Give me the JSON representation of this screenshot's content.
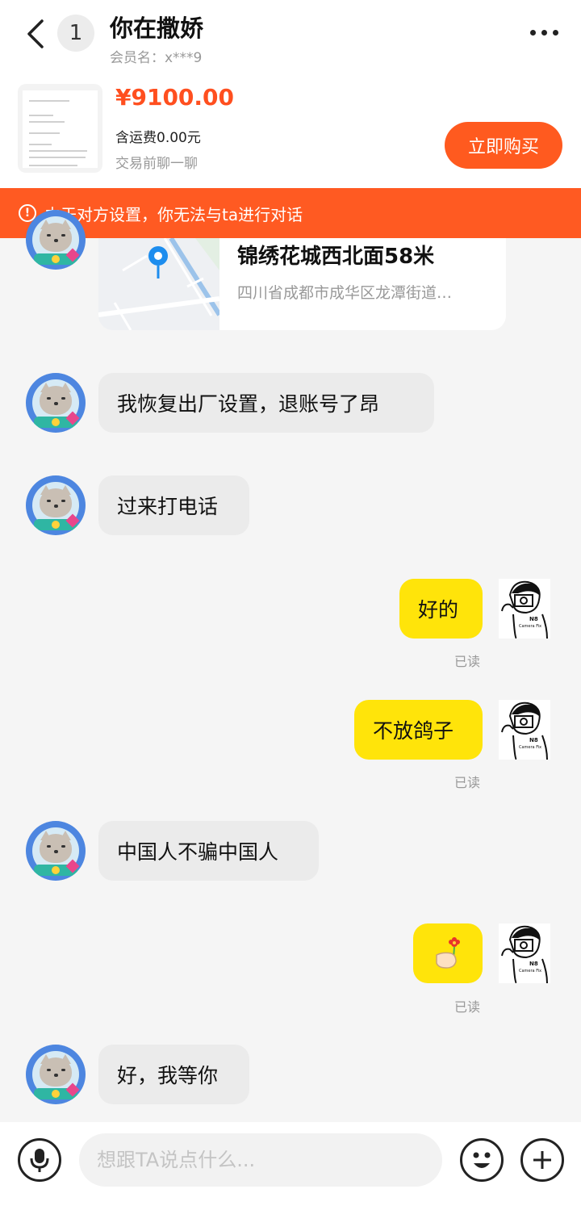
{
  "header": {
    "unread_count": "1",
    "title": "你在撒娇",
    "member_label": "会员名：x***9"
  },
  "product": {
    "price": "¥9100.00",
    "shipping": "含运费0.00元",
    "hint": "交易前聊一聊",
    "buy_label": "立即购买"
  },
  "warning": {
    "icon": "!",
    "text": "由于对方设置，你无法与ta进行对话"
  },
  "location": {
    "title": "锦绣花城西北面58米",
    "address": "四川省成都市成华区龙潭街道…"
  },
  "messages": [
    {
      "side": "in",
      "text": "我恢复出厂设置，退账号了昂"
    },
    {
      "side": "in",
      "text": "过来打电话"
    },
    {
      "side": "out",
      "text": "好的",
      "status": "已读"
    },
    {
      "side": "out",
      "text": "不放鸽子",
      "status": "已读"
    },
    {
      "side": "in",
      "text": "中国人不骗中国人"
    },
    {
      "side": "out",
      "text": "",
      "sticker": "flower-hand-sticker",
      "status": "已读"
    },
    {
      "side": "in",
      "text": "好，我等你"
    }
  ],
  "my_avatar_text": {
    "line1": "N8",
    "line2": "Camera Fix"
  },
  "input": {
    "placeholder": "想跟TA说点什么..."
  },
  "colors": {
    "accent": "#ff5a1f",
    "warning_bg": "#ff5a22",
    "out_bubble": "#ffe40a",
    "in_bubble": "#ebebeb"
  }
}
